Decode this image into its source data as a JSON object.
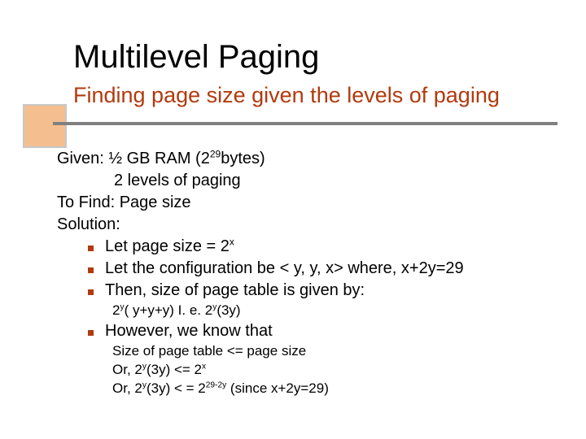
{
  "title": "Multilevel Paging",
  "subtitle": "Finding page size given the levels of paging",
  "lines": {
    "given_label": "Given: ",
    "given_1a": "½ GB RAM (2",
    "given_1sup": "29",
    "given_1b": "bytes)",
    "given_2": "2 levels of paging",
    "tofind": "To Find: Page size",
    "solution": "Solution:",
    "b1a": "Let page size = 2",
    "b1sup": "x",
    "b2": "Let the configuration be < y, y, x> where, x+2y=29",
    "b3": "Then, size of page table is given by:",
    "eq1a": "2",
    "eq1sup1": "y",
    "eq1b": "( y+y+y) I. e. 2",
    "eq1sup2": "y",
    "eq1c": "(3y)",
    "b4": "However, we know that",
    "eq2": "Size of page table <= page size",
    "eq3a": "Or, 2",
    "eq3sup": "y",
    "eq3b": "(3y) <= 2",
    "eq3sup2": "x",
    "eq4a": "Or, 2",
    "eq4sup": "y",
    "eq4b": "(3y) < = 2",
    "eq4sup2": "29-2y",
    "eq4c": " (since x+2y=29)"
  }
}
